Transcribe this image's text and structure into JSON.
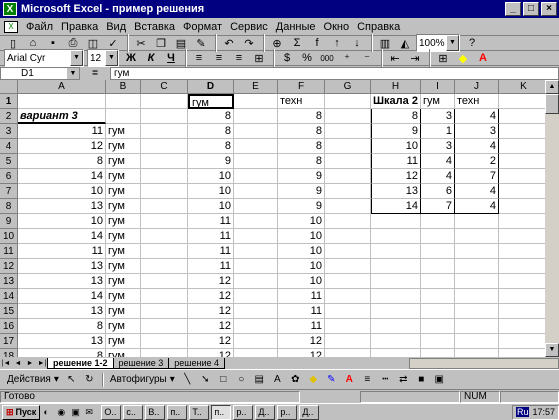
{
  "window": {
    "title": "Microsoft Excel - пример решения"
  },
  "menu": [
    "Файл",
    "Правка",
    "Вид",
    "Вставка",
    "Формат",
    "Сервис",
    "Данные",
    "Окно",
    "Справка"
  ],
  "toolbar": {
    "zoom": "100%",
    "font": "Arial Cyr",
    "size": "12",
    "bold": "Ж",
    "italic": "К",
    "underline": "Ч",
    "percent": "%",
    "thousands": "000",
    "sigma": "Σ",
    "fx": "f",
    "fill": "▾",
    "font_color": "A"
  },
  "formula_bar": {
    "cell_ref": "D1",
    "equals": "=",
    "content": "гум"
  },
  "columns": [
    "A",
    "B",
    "C",
    "D",
    "E",
    "F",
    "G",
    "H",
    "I",
    "J",
    "K"
  ],
  "rows": [
    "1",
    "2",
    "3",
    "4",
    "5",
    "6",
    "7",
    "8",
    "9",
    "10",
    "11",
    "12",
    "13",
    "14",
    "15",
    "16",
    "17",
    "18",
    "19"
  ],
  "cells": {
    "A": [
      "",
      "вариант 3",
      "11",
      "12",
      "8",
      "14",
      "10",
      "13",
      "10",
      "14",
      "11",
      "13",
      "13",
      "14",
      "13",
      "8",
      "13",
      "8",
      "12"
    ],
    "B": [
      "",
      "",
      "гум",
      "гум",
      "гум",
      "гум",
      "гум",
      "гум",
      "гум",
      "гум",
      "гум",
      "гум",
      "гум",
      "гум",
      "гум",
      "гум",
      "гум",
      "гум",
      "гум"
    ],
    "D": [
      "гум",
      "8",
      "8",
      "8",
      "9",
      "10",
      "10",
      "10",
      "11",
      "11",
      "11",
      "11",
      "12",
      "12",
      "12",
      "12",
      "12",
      "12",
      "12"
    ],
    "F": [
      "техн",
      "8",
      "8",
      "8",
      "8",
      "9",
      "9",
      "9",
      "10",
      "10",
      "10",
      "10",
      "10",
      "11",
      "11",
      "11",
      "12",
      "12",
      "12"
    ],
    "H": [
      "Шкала 2",
      "8",
      "9",
      "10",
      "11",
      "12",
      "13",
      "14"
    ],
    "I": [
      "гум",
      "3",
      "1",
      "3",
      "4",
      "4",
      "6",
      "7"
    ],
    "J": [
      "техн",
      "4",
      "3",
      "4",
      "2",
      "7",
      "4",
      "4"
    ]
  },
  "sheet_tabs": [
    "решение 1-2",
    "решение 3",
    "решение 4"
  ],
  "drawing": {
    "actions": "Действия",
    "autoshapes": "Автофигуры"
  },
  "status": {
    "ready": "Готово",
    "num": "NUM"
  },
  "taskbar": {
    "start": "Пуск",
    "items": [
      "О..",
      "с..",
      "В..",
      "п..",
      "Т..",
      "п..",
      "р..",
      "Д..",
      "р..",
      "Д.."
    ],
    "lang": "Ru",
    "clock": "17:57"
  }
}
